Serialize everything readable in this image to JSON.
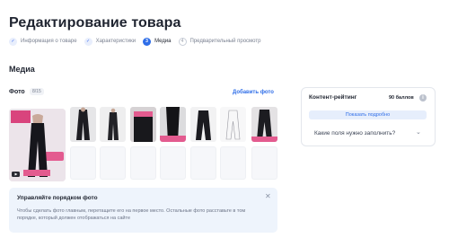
{
  "page": {
    "title": "Редактирование товара"
  },
  "steps": [
    {
      "number": "✓",
      "label": "Информация о товаре",
      "state": "done"
    },
    {
      "number": "✓",
      "label": "Характеристики",
      "state": "done"
    },
    {
      "number": "3",
      "label": "Медиа",
      "state": "active"
    },
    {
      "number": "4",
      "label": "Предварительный просмотр",
      "state": "pending"
    }
  ],
  "media": {
    "section_title": "Медиа",
    "photo_label": "Фото",
    "photo_count": "8/15",
    "add_photo": "Добавить фото",
    "video_icon": "play-icon"
  },
  "info": {
    "title": "Управляйте порядком фото",
    "text": "Чтобы сделать фото главным, перетащите его на первое место. Остальные фото расставьте в том порядке, который должен отображаться на сайте",
    "close": "✕"
  },
  "rating": {
    "label": "Контент-рейтинг",
    "value": "90 баллов",
    "info_icon": "i",
    "show_button": "Показать подробно",
    "which_fields": "Какие поля нужно заполнить?",
    "chevron": "⌄"
  },
  "colors": {
    "accent": "#2f6ee8",
    "info_bg": "#eef4fc"
  }
}
